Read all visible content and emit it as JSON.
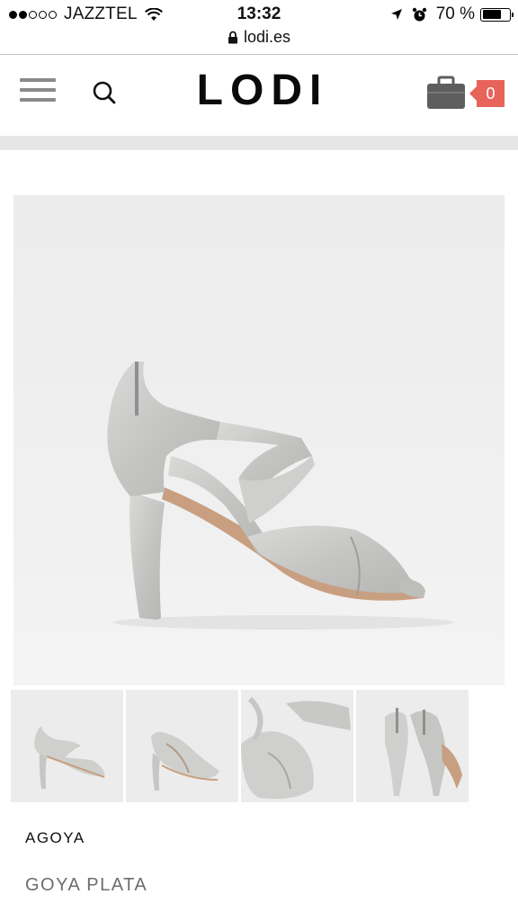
{
  "status_bar": {
    "carrier": "JAZZTEL",
    "time": "13:32",
    "battery": "70 %",
    "battery_level": 0.7,
    "icons": [
      "signal-dots-icon",
      "wifi-icon",
      "location-arrow-icon",
      "alarm-clock-icon",
      "battery-icon"
    ]
  },
  "browser": {
    "url": "lodi.es"
  },
  "header": {
    "logo": "LODI",
    "cart_count": "0",
    "icons": [
      "hamburger-menu-icon",
      "search-icon",
      "briefcase-cart-icon"
    ]
  },
  "product": {
    "brand": "AGOYA",
    "name": "GOYA PLATA",
    "main_image": "silver strappy high-heel sandal side view",
    "thumbnails": [
      "side view",
      "three-quarter view",
      "close-up toe detail",
      "back heel view"
    ]
  },
  "colors": {
    "badge": "#e8635a",
    "icon_gray": "#8a8a8a",
    "cart_gray": "#5e5e5e",
    "band": "#e6e6e6"
  }
}
